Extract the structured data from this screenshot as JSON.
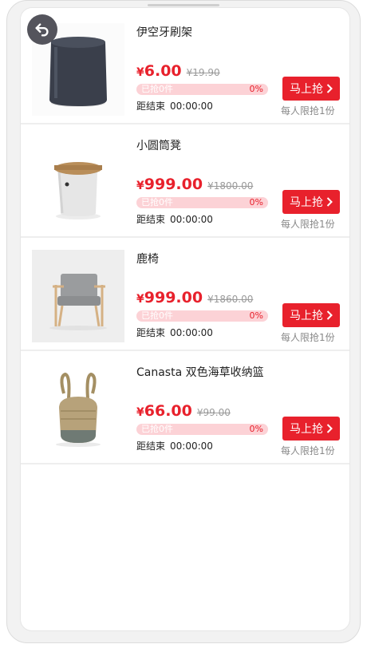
{
  "colors": {
    "accent": "#e8212c",
    "progress_bg": "#fcd2d6",
    "muted": "#9a9a9a"
  },
  "nav": {
    "back_icon": "back-arrow-icon"
  },
  "items": [
    {
      "title": "伊空牙刷架",
      "currency": "¥",
      "price": "6.00",
      "original_price": "¥19.90",
      "sold_label": "已抢0件",
      "percent_label": "0%",
      "progress": 0,
      "countdown_label": "距结束",
      "countdown_time": "00:00:00",
      "button_label": "马上抢",
      "limit_label": "每人限抢1份",
      "image_icon": "stool-dark-image"
    },
    {
      "title": "小圆筒凳",
      "currency": "¥",
      "price": "999.00",
      "original_price": "¥1800.00",
      "sold_label": "已抢0件",
      "percent_label": "0%",
      "progress": 0,
      "countdown_label": "距结束",
      "countdown_time": "00:00:00",
      "button_label": "马上抢",
      "limit_label": "每人限抢1份",
      "image_icon": "round-stool-image"
    },
    {
      "title": "鹿椅",
      "currency": "¥",
      "price": "999.00",
      "original_price": "¥1860.00",
      "sold_label": "已抢0件",
      "percent_label": "0%",
      "progress": 0,
      "countdown_label": "距结束",
      "countdown_time": "00:00:00",
      "button_label": "马上抢",
      "limit_label": "每人限抢1份",
      "image_icon": "armchair-image"
    },
    {
      "title": "Canasta 双色海草收纳篮",
      "currency": "¥",
      "price": "66.00",
      "original_price": "¥99.00",
      "sold_label": "已抢0件",
      "percent_label": "0%",
      "progress": 0,
      "countdown_label": "距结束",
      "countdown_time": "00:00:00",
      "button_label": "马上抢",
      "limit_label": "每人限抢1份",
      "image_icon": "seagrass-basket-image"
    }
  ]
}
